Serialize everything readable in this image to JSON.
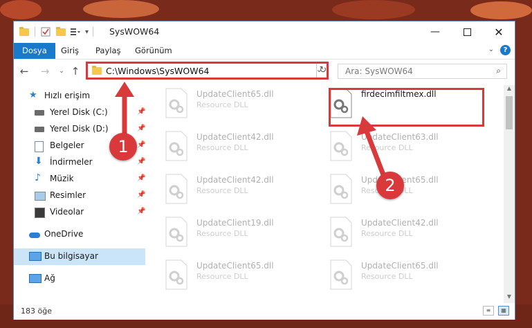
{
  "window": {
    "title": "SysWOW64",
    "controls": [
      "minimize-icon",
      "maximize-icon",
      "close-icon"
    ]
  },
  "quick_access_toolbar": [
    "folder-icon",
    "properties-check-icon",
    "new-folder-icon",
    "customize-dropdown-icon"
  ],
  "ribbon": {
    "tabs": [
      {
        "label": "Dosya",
        "active": true
      },
      {
        "label": "Giriş",
        "active": false
      },
      {
        "label": "Paylaş",
        "active": false
      },
      {
        "label": "Görünüm",
        "active": false
      }
    ]
  },
  "nav": {
    "back_icon": "back-arrow-icon",
    "forward_icon": "forward-arrow-icon",
    "recent_icon": "chevron-down-icon",
    "up_icon": "up-arrow-icon",
    "address_path": "C:\\Windows\\SysWOW64",
    "search_placeholder": "Ara: SysWOW64"
  },
  "sidebar": {
    "items": [
      {
        "label": "Hızlı erişim",
        "icon": "star-icon",
        "pinned": false
      },
      {
        "label": "Yerel Disk (C:)",
        "icon": "drive-icon",
        "pinned": true
      },
      {
        "label": "Yerel Disk (D:)",
        "icon": "drive-icon",
        "pinned": true
      },
      {
        "label": "Belgeler",
        "icon": "documents-icon",
        "pinned": true
      },
      {
        "label": "İndirmeler",
        "icon": "download-icon",
        "pinned": true
      },
      {
        "label": "Müzik",
        "icon": "music-icon",
        "pinned": true
      },
      {
        "label": "Resimler",
        "icon": "pictures-icon",
        "pinned": true
      },
      {
        "label": "Videolar",
        "icon": "videos-icon",
        "pinned": true
      },
      {
        "label": "OneDrive",
        "icon": "cloud-icon",
        "pinned": false
      },
      {
        "label": "Bu bilgisayar",
        "icon": "computer-icon",
        "pinned": false,
        "selected": true
      },
      {
        "label": "Ağ",
        "icon": "network-icon",
        "pinned": false
      }
    ]
  },
  "files": {
    "left_column": [
      {
        "name": "UpdateClient65.dll",
        "type": "Resource DLL"
      },
      {
        "name": "UpdateClient42.dll",
        "type": "Resource DLL"
      },
      {
        "name": "UpdateClient42.dll",
        "type": "Resource DLL"
      },
      {
        "name": "UpdateClient19.dll",
        "type": "Resource DLL"
      },
      {
        "name": "UpdateClient65.dll",
        "type": "Resource DLL"
      }
    ],
    "right_column": [
      {
        "name": "firdecimfiltmex.dll",
        "type": "",
        "highlighted": true
      },
      {
        "name": "UpdateClient63.dll",
        "type": "Resource DLL"
      },
      {
        "name": "UpdateClient65.dll",
        "type": "Resource DLL"
      },
      {
        "name": "UpdateClient42.dll",
        "type": "Resource DLL"
      },
      {
        "name": "UpdateClient65.dll",
        "type": "Resource DLL"
      }
    ]
  },
  "status": {
    "item_count": "183 öğe"
  },
  "annotations": {
    "marker_1": "1",
    "marker_2": "2",
    "color": "#d9393b"
  },
  "colors": {
    "accent": "#1979ca",
    "highlight_red": "#d9393b",
    "selection": "#cce4f7"
  }
}
